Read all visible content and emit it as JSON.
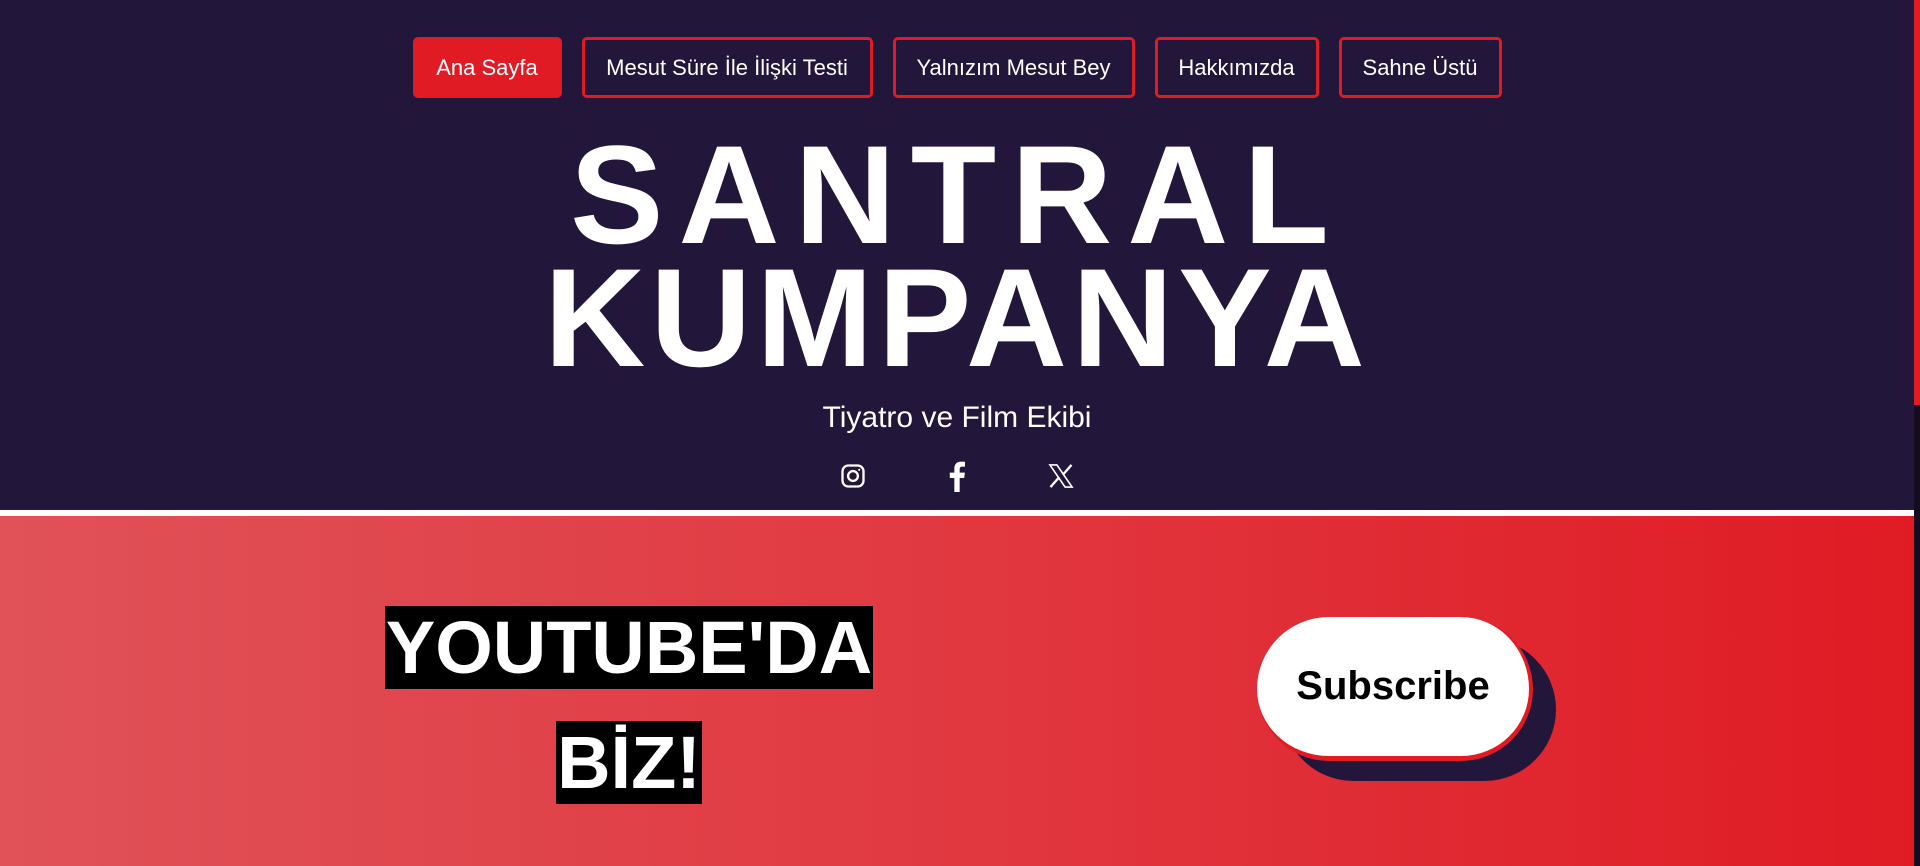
{
  "nav": {
    "items": [
      {
        "label": "Ana Sayfa",
        "active": true
      },
      {
        "label": "Mesut Süre İle İlişki Testi",
        "active": false
      },
      {
        "label": "Yalnızım Mesut Bey",
        "active": false
      },
      {
        "label": "Hakkımızda",
        "active": false
      },
      {
        "label": "Sahne Üstü",
        "active": false
      }
    ]
  },
  "hero": {
    "title_line1": "SANTRAL",
    "title_line2": "KUMPANYA",
    "tagline": "Tiyatro ve Film Ekibi"
  },
  "social": {
    "icons": [
      "instagram-icon",
      "facebook-icon",
      "x-icon"
    ]
  },
  "youtube": {
    "title_line1": "YOUTUBE'DA",
    "title_line2": "BİZ!",
    "subscribe_label": "Subscribe"
  },
  "colors": {
    "background": "#22163a",
    "accent": "#e01b24",
    "gradient_start": "#e05258",
    "gradient_end": "#e01b24"
  }
}
